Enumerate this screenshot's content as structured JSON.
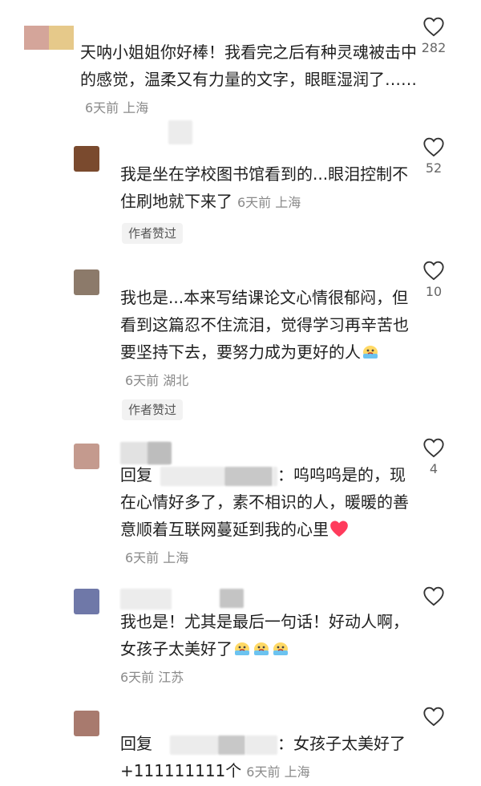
{
  "comments": [
    {
      "text": "天呐小姐姐你好棒！我看完之后有种灵魂被击中的感觉，温柔又有力量的文字，眼眶湿润了……",
      "time": "6天前",
      "location": "上海",
      "likes": "282",
      "avatar_colors": [
        "#d4a59a",
        "#e6c98a"
      ]
    },
    {
      "text": "我是坐在学校图书馆看到的...眼泪控制不住刷地就下来了",
      "time": "6天前",
      "location": "上海",
      "likes": "52",
      "badge": "作者赞过",
      "avatar_color": "#7a4a2e"
    },
    {
      "text": "我也是...本来写结课论文心情很郁闷，但看到这篇忍不住流泪，觉得学习再辛苦也要坚持下去，要努力成为更好的人",
      "time": "6天前",
      "location": "湖北",
      "likes": "10",
      "badge": "作者赞过",
      "avatar_color": "#8c7a6a"
    },
    {
      "reply_prefix": "回复",
      "text_after_mention": "：呜呜呜是的，现在心情好多了，素不相识的人，暖暖的善意顺着互联网蔓延到我的心里",
      "time": "6天前",
      "location": "上海",
      "likes": "4",
      "avatar_color": "#c49a8e"
    },
    {
      "text": "我也是！尤其是最后一句话！好动人啊，女孩子太美好了",
      "time": "6天前",
      "location": "江苏",
      "avatar_color": "#6f78a8"
    },
    {
      "reply_prefix": "回复",
      "text_after_mention": "：女孩子太美好了 +111111111个",
      "time": "6天前",
      "location": "上海",
      "avatar_color": "#a87a6e"
    }
  ],
  "icons": {
    "like": "heart-outline-icon",
    "emoji_cry": "crying-face-emoji",
    "emoji_heart": "red-heart-emoji"
  },
  "colors": {
    "meta": "#8a8a8a",
    "badge_bg": "#f2f2f2",
    "heart_red": "#ff3b5c"
  }
}
